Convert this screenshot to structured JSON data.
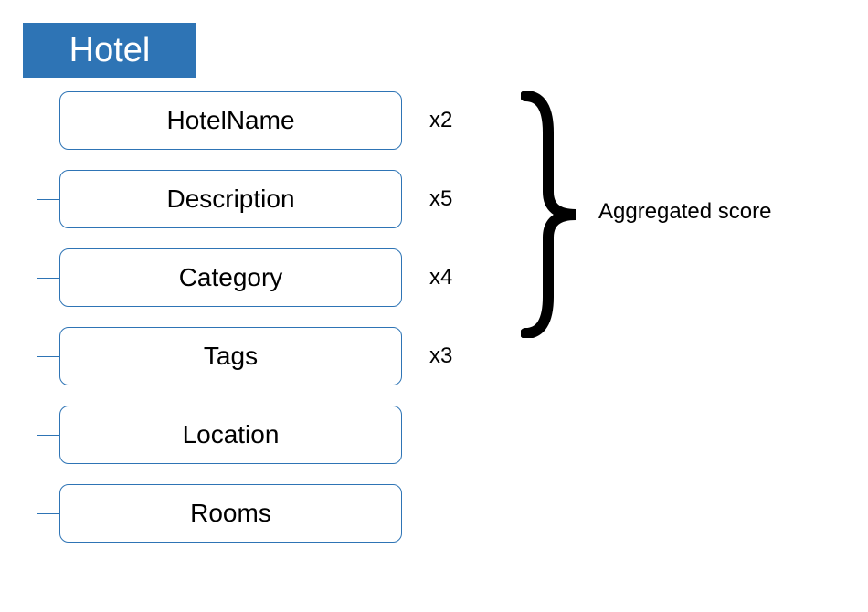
{
  "root": {
    "label": "Hotel"
  },
  "fields": [
    {
      "label": "HotelName",
      "multiplier": "x2"
    },
    {
      "label": "Description",
      "multiplier": "x5"
    },
    {
      "label": "Category",
      "multiplier": "x4"
    },
    {
      "label": "Tags",
      "multiplier": "x3"
    },
    {
      "label": "Location",
      "multiplier": ""
    },
    {
      "label": "Rooms",
      "multiplier": ""
    }
  ],
  "aggregate_label": "Aggregated score"
}
